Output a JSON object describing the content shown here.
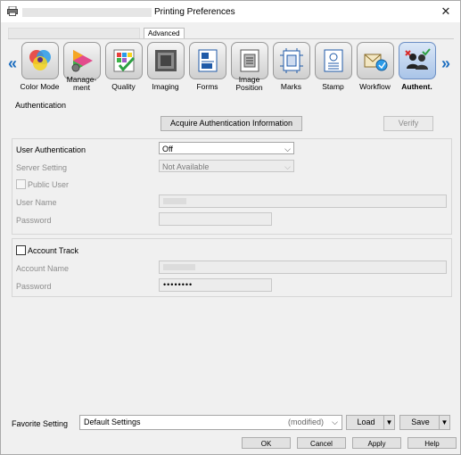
{
  "window": {
    "title": "Printing Preferences",
    "close_glyph": "✕"
  },
  "tabs": {
    "advanced_label": "Advanced"
  },
  "nav": {
    "left_glyph": "«",
    "right_glyph": "»"
  },
  "icon_tabs": [
    {
      "label": "Color Mode",
      "icon": "color-wheel-icon"
    },
    {
      "label": "Manage-\nment",
      "icon": "management-icon"
    },
    {
      "label": "Quality",
      "icon": "quality-icon"
    },
    {
      "label": "Imaging",
      "icon": "imaging-icon"
    },
    {
      "label": "Forms",
      "icon": "forms-icon"
    },
    {
      "label": "Image\nPosition",
      "icon": "image-position-icon"
    },
    {
      "label": "Marks",
      "icon": "marks-icon"
    },
    {
      "label": "Stamp",
      "icon": "stamp-icon"
    },
    {
      "label": "Workflow",
      "icon": "workflow-icon"
    },
    {
      "label": "Authent.",
      "icon": "authentication-icon",
      "selected": true
    }
  ],
  "auth": {
    "section_title": "Authentication",
    "acquire_button": "Acquire Authentication Information",
    "verify_button": "Verify",
    "user_auth_label": "User Authentication",
    "user_auth_value": "Off",
    "server_setting_label": "Server Setting",
    "server_setting_value": "Not Available",
    "public_user_label": "Public User",
    "user_name_label": "User Name",
    "password_label": "Password"
  },
  "account": {
    "account_track_label": "Account Track",
    "account_name_label": "Account Name",
    "password_label": "Password",
    "password_value": "••••••••"
  },
  "footer": {
    "favorite_label": "Favorite Setting",
    "favorite_value": "Default Settings",
    "favorite_modified": "(modified)",
    "load_button": "Load",
    "save_button": "Save",
    "ok_button": "OK",
    "cancel_button": "Cancel",
    "apply_button": "Apply",
    "help_button": "Help"
  }
}
